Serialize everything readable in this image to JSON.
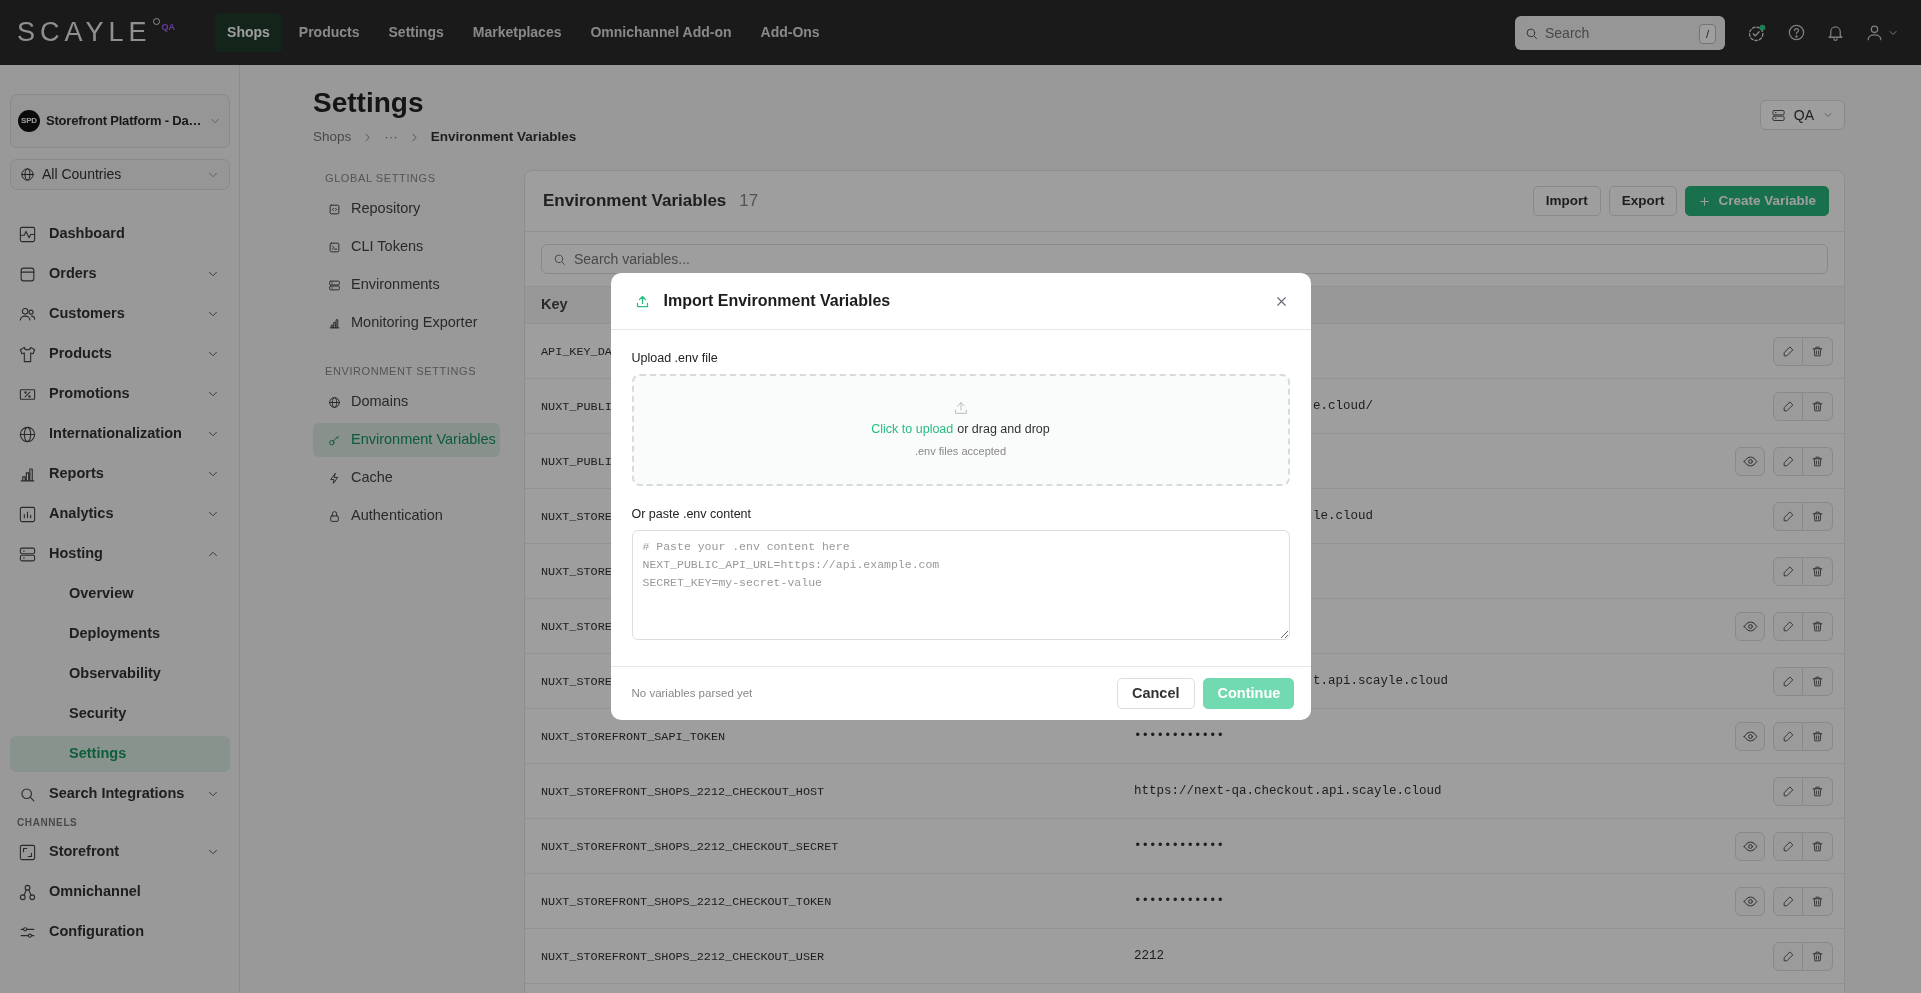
{
  "topbar": {
    "logo": "SCAYLE",
    "env_badge": "QA",
    "nav": [
      {
        "label": "Shops",
        "selected": true
      },
      {
        "label": "Products",
        "selected": false
      },
      {
        "label": "Settings",
        "selected": false
      },
      {
        "label": "Marketplaces",
        "selected": false
      },
      {
        "label": "Omnichannel Add-on",
        "selected": false
      },
      {
        "label": "Add-Ons",
        "selected": false
      }
    ],
    "search": {
      "placeholder": "Search",
      "shortcut": "/"
    }
  },
  "sidebar": {
    "shop_selector": {
      "avatar": "SPD",
      "label": "Storefront Platform - Da…"
    },
    "country_selector": {
      "label": "All Countries"
    },
    "sections": [
      {
        "items": [
          {
            "label": "Dashboard",
            "selected": false
          },
          {
            "label": "Orders",
            "selected": false,
            "expanded": false
          },
          {
            "label": "Customers",
            "selected": false,
            "expanded": false
          },
          {
            "label": "Products",
            "selected": false,
            "expanded": false
          },
          {
            "label": "Promotions",
            "selected": false,
            "expanded": false
          },
          {
            "label": "Internationalization",
            "selected": false,
            "expanded": false
          },
          {
            "label": "Reports",
            "selected": false,
            "expanded": false
          },
          {
            "label": "Analytics",
            "selected": false,
            "expanded": false
          },
          {
            "label": "Hosting",
            "selected": false,
            "expanded": true,
            "children": [
              {
                "label": "Overview",
                "selected": false
              },
              {
                "label": "Deployments",
                "selected": false
              },
              {
                "label": "Observability",
                "selected": false
              },
              {
                "label": "Security",
                "selected": false
              },
              {
                "label": "Settings",
                "selected": true
              }
            ]
          },
          {
            "label": "Search Integrations",
            "selected": false,
            "expanded": false
          }
        ]
      },
      {
        "title": "CHANNELS",
        "items": [
          {
            "label": "Storefront",
            "selected": false,
            "expanded": false
          },
          {
            "label": "Omnichannel",
            "selected": false
          },
          {
            "label": "Configuration",
            "selected": false
          }
        ]
      }
    ]
  },
  "page": {
    "title": "Settings",
    "breadcrumb": [
      "Shops",
      "···",
      "Environment Variables"
    ],
    "environment_selector": {
      "label": "QA"
    }
  },
  "settings_nav": [
    {
      "title": "GLOBAL SETTINGS",
      "items": [
        {
          "label": "Repository",
          "selected": false
        },
        {
          "label": "CLI Tokens",
          "selected": false
        },
        {
          "label": "Environments",
          "selected": false
        },
        {
          "label": "Monitoring Exporter",
          "selected": false
        }
      ]
    },
    {
      "title": "ENVIRONMENT SETTINGS",
      "items": [
        {
          "label": "Domains",
          "selected": false
        },
        {
          "label": "Environment Variables",
          "selected": true
        },
        {
          "label": "Cache",
          "selected": false
        },
        {
          "label": "Authentication",
          "selected": false
        }
      ]
    }
  ],
  "variables_card": {
    "title": "Environment Variables",
    "count": "17",
    "buttons": [
      {
        "label": "Import",
        "kind": "secondary"
      },
      {
        "label": "Export",
        "kind": "secondary"
      },
      {
        "label": "Create Variable",
        "kind": "primary"
      }
    ],
    "search": {
      "placeholder": "Search variables..."
    },
    "columns": [
      "Key"
    ],
    "rows": [
      {
        "key": "API_KEY_DA",
        "revealable": false
      },
      {
        "key": "NUXT_PUBLI",
        "value": "e.cloud/",
        "value_cut": true,
        "revealable": false
      },
      {
        "key": "NUXT_PUBLI",
        "revealable": true
      },
      {
        "key": "NUXT_STORE",
        "value": "le.cloud",
        "value_cut": true,
        "revealable": false
      },
      {
        "key": "NUXT_STORE",
        "revealable": false
      },
      {
        "key": "NUXT_STORE",
        "revealable": true
      },
      {
        "key": "NUXT_STORE",
        "value": "t.api.scayle.cloud",
        "value_cut": true,
        "revealable": false
      },
      {
        "key": "NUXT_STOREFRONT_SAPI_TOKEN",
        "value": "••••••••••••",
        "revealable": true
      },
      {
        "key": "NUXT_STOREFRONT_SHOPS_2212_CHECKOUT_HOST",
        "value": "https://next-qa.checkout.api.scayle.cloud",
        "revealable": false
      },
      {
        "key": "NUXT_STOREFRONT_SHOPS_2212_CHECKOUT_SECRET",
        "value": "••••••••••••",
        "revealable": true
      },
      {
        "key": "NUXT_STOREFRONT_SHOPS_2212_CHECKOUT_TOKEN",
        "value": "••••••••••••",
        "revealable": true
      },
      {
        "key": "NUXT_STOREFRONT_SHOPS_2212_CHECKOUT_USER",
        "value": "2212",
        "revealable": false
      }
    ]
  },
  "modal": {
    "title": "Import Environment Variables",
    "upload_label": "Upload .env file",
    "dropzone": {
      "link": "Click to upload",
      "text": "or drag and drop",
      "hint": ".env files accepted"
    },
    "paste_label": "Or paste .env content",
    "textarea": {
      "placeholder": "# Paste your .env content here\nNEXT_PUBLIC_API_URL=https://api.example.com\nSECRET_KEY=my-secret-value"
    },
    "status": "No variables parsed yet",
    "buttons": [
      {
        "label": "Cancel",
        "kind": "secondary",
        "disabled": false
      },
      {
        "label": "Continue",
        "kind": "primary",
        "disabled": true
      }
    ]
  }
}
